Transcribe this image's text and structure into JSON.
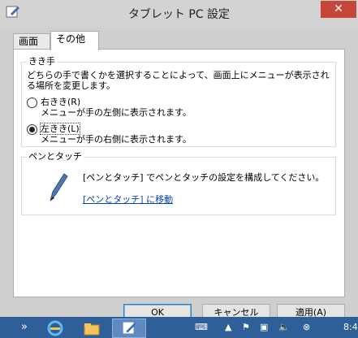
{
  "window": {
    "title": "タブレット PC 設定",
    "close_label": "✕",
    "icon": "tablet-pen-icon"
  },
  "tabs": [
    {
      "label": "画面",
      "active": false
    },
    {
      "label": "その他",
      "active": true
    }
  ],
  "hand": {
    "title": "きき手",
    "description": "どちらの手で書くかを選択することによって、画面上にメニューが表示される場所を変更します。",
    "options": [
      {
        "label": "右きき(R)",
        "sublabel": "メニューが手の左側に表示されます。",
        "checked": false
      },
      {
        "label": "左きき(L)",
        "sublabel": "メニューが手の右側に表示されます。",
        "checked": true
      }
    ]
  },
  "pen": {
    "title": "ペンとタッチ",
    "description": "[ペンとタッチ] でペンとタッチの設定を構成してください。",
    "link": "[ペンとタッチ] に移動",
    "icon": "pen-icon"
  },
  "buttons": {
    "ok": "OK",
    "cancel": "キャンセル",
    "apply": "適用(A)"
  },
  "taskbar": {
    "chevron": "»",
    "clock": "8:4",
    "colors": {
      "taskbar": "#2f5f99",
      "close": "#c7463a"
    }
  }
}
